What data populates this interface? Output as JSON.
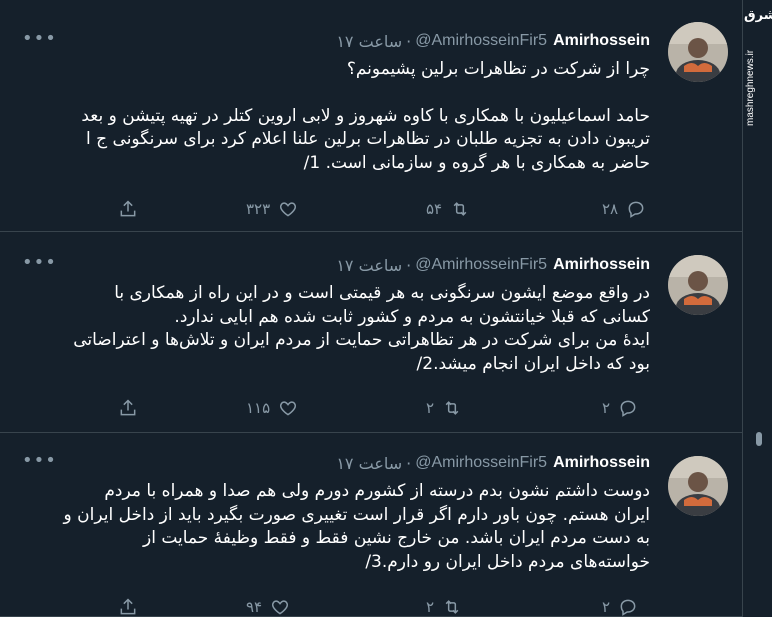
{
  "watermark": {
    "logo_text": "مشرق",
    "site": "mashreghnews.ir"
  },
  "tweets": [
    {
      "name": "Amirhossein",
      "handle": "@AmirhosseinFir5",
      "time": "۱۷ ساعت",
      "lines": [
        "چرا از شرکت در تظاهرات برلین پشیمونم؟",
        "",
        "حامد اسماعیلیون با همکاری با کاوه شهروز و لابی اروین کتلر در تهیه پتیشن و بعد",
        "تریبون دادن به تجزیه طلبان در تظاهرات برلین علنا اعلام کرد برای سرنگونی ج ا",
        "حاضر به همکاری با هر گروه و سازمانی است. 1/"
      ],
      "replies": "۲۸",
      "retweets": "۵۴",
      "likes": "۳۲۳"
    },
    {
      "name": "Amirhossein",
      "handle": "@AmirhosseinFir5",
      "time": "۱۷ ساعت",
      "lines": [
        "در واقع موضع ایشون سرنگونی به هر قیمتی است و در این راه از همکاری با",
        "کسانی که قبلا خیانتشون به مردم و کشور ثابت شده هم ابایی ندارد.",
        "ایدهٔ من برای شرکت در هر تظاهراتی حمایت از مردم ایران و تلاش‌ها و اعتراضاتی",
        "بود که داخل ایران انجام میشد.2/"
      ],
      "replies": "۲",
      "retweets": "۲",
      "likes": "۱۱۵"
    },
    {
      "name": "Amirhossein",
      "handle": "@AmirhosseinFir5",
      "time": "۱۷ ساعت",
      "lines": [
        "دوست داشتم نشون بدم درسته از کشورم دورم ولی هم صدا و همراه با مردم",
        "ایران هستم. چون باور دارم اگر قرار است تغییری صورت بگیرد باید از داخل ایران و",
        "به دست مردم ایران باشد. من خارج نشین فقط و فقط وظیفهٔ حمایت از",
        "خواسته‌های مردم داخل ایران رو دارم.3/"
      ],
      "replies": "۲",
      "retweets": "۲",
      "likes": "۹۴"
    }
  ],
  "icons": {
    "more": "more-icon",
    "reply": "reply-icon",
    "retweet": "retweet-icon",
    "like": "heart-icon",
    "share": "share-icon"
  },
  "colors": {
    "background": "#15202b",
    "border": "#38444d",
    "muted": "#8899a6",
    "text": "#ffffff"
  }
}
